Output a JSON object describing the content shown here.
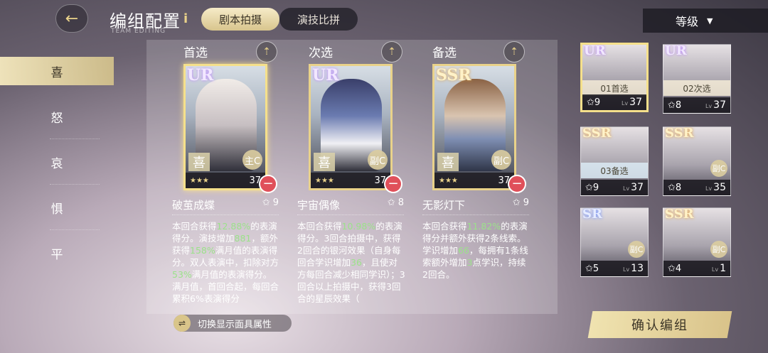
{
  "header": {
    "back_icon": "back-arrow-icon",
    "title": "编组配置",
    "subtitle": "TEAM EDITING",
    "info": "i",
    "tabs": [
      {
        "label": "剧本拍摄",
        "active": true
      },
      {
        "label": "演技比拼",
        "active": false
      }
    ],
    "sort_label": "等级"
  },
  "sidebar": {
    "items": [
      {
        "label": "喜",
        "active": true
      },
      {
        "label": "怒",
        "active": false
      },
      {
        "label": "哀",
        "active": false
      },
      {
        "label": "惧",
        "active": false
      },
      {
        "label": "平",
        "active": false
      }
    ]
  },
  "slots": [
    {
      "label": "首选",
      "rarity": "UR",
      "mood": "喜",
      "role": "主C",
      "level": "37",
      "skill": "破茧成蝶",
      "skill_level": "9",
      "desc": [
        "本回合获得",
        "12.88%",
        "的表演得分。演技增加",
        "881",
        "，额外获得",
        "158%",
        "满月值的表演得分。双人表演中，扣除对方",
        "53%",
        "满月值的表演得分。满月值，首回合起，每回合累积6%表演得分"
      ]
    },
    {
      "label": "次选",
      "rarity": "UR",
      "mood": "喜",
      "role": "副C",
      "level": "37",
      "skill": "宇宙偶像",
      "skill_level": "8",
      "desc": [
        "本回合获得",
        "10.98%",
        "的表演得分。3回合拍摄中，获得2回合的银河效果（自身每回合学识增加",
        "36",
        "，且使对方每回合减少相同学识）；3回合以上拍摄中，获得3回合的星辰效果（"
      ]
    },
    {
      "label": "备选",
      "rarity": "SSR",
      "mood": "喜",
      "role": "副C",
      "level": "37",
      "skill": "无影灯下",
      "skill_level": "9",
      "desc": [
        "本回合获得",
        "11.82%",
        "的表演得分并额外获得2条线索。学识增加",
        "66",
        "，每拥有1条线索额外增加",
        "3",
        "点学识，持续2回合。"
      ]
    }
  ],
  "toggle_label": "切换显示面具属性",
  "roster": [
    {
      "rarity": "UR",
      "tag": "01首选",
      "stars": "9",
      "level": "37"
    },
    {
      "rarity": "UR",
      "tag": "02次选",
      "stars": "8",
      "level": "37"
    },
    {
      "rarity": "SSR",
      "tag": "03备选",
      "stars": "9",
      "level": "37"
    },
    {
      "rarity": "SSR",
      "role": "副C",
      "stars": "8",
      "level": "35"
    },
    {
      "rarity": "SR",
      "role": "副C",
      "stars": "5",
      "level": "13"
    },
    {
      "rarity": "SSR",
      "role": "副C",
      "stars": "4",
      "level": "1"
    }
  ],
  "confirm_label": "确认编组"
}
